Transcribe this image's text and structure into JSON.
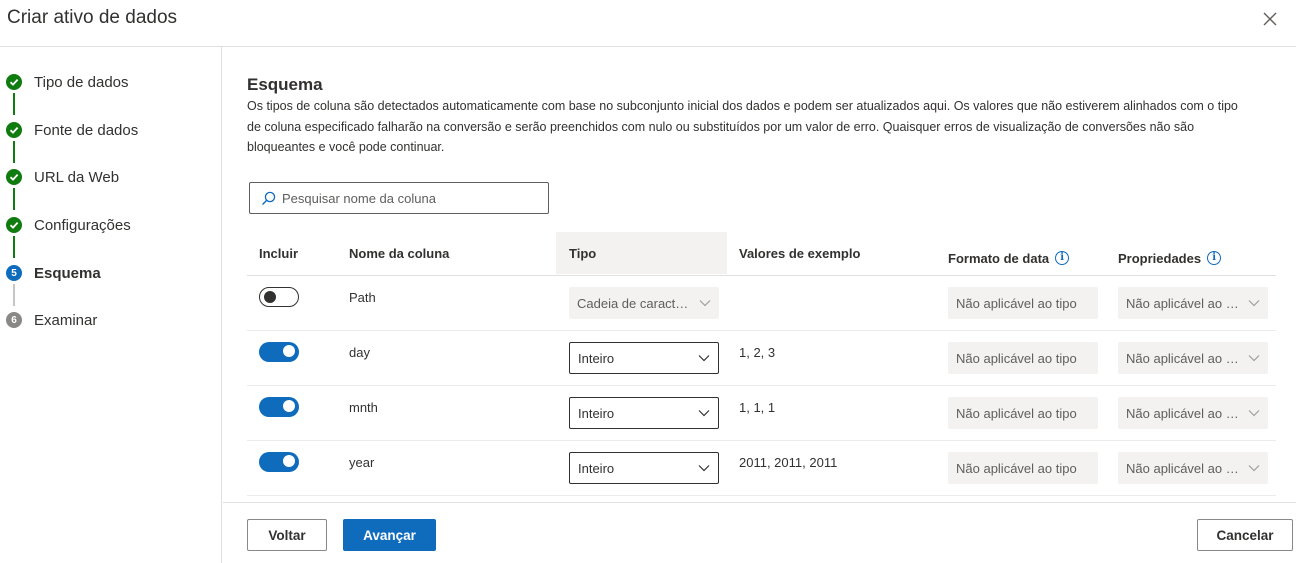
{
  "dialog": {
    "title": "Criar ativo de dados"
  },
  "steps": [
    {
      "label": "Tipo de dados",
      "state": "done"
    },
    {
      "label": "Fonte de dados",
      "state": "done"
    },
    {
      "label": "URL da Web",
      "state": "done"
    },
    {
      "label": "Configurações",
      "state": "done"
    },
    {
      "label": "Esquema",
      "state": "current",
      "number": "5"
    },
    {
      "label": "Examinar",
      "state": "pending",
      "number": "6"
    }
  ],
  "schema": {
    "title": "Esquema",
    "description": "Os tipos de coluna são detectados automaticamente com base no subconjunto inicial dos dados e podem ser atualizados aqui. Os valores que não estiverem alinhados com o tipo de coluna especificado falharão na conversão e serão preenchidos com nulo ou substituídos por um valor de erro. Quaisquer erros de visualização de conversões não são bloqueantes e você pode continuar.",
    "search_placeholder": "Pesquisar nome da coluna"
  },
  "table": {
    "headers": {
      "include": "Incluir",
      "column_name": "Nome da coluna",
      "type": "Tipo",
      "sample_values": "Valores de exemplo",
      "date_format": "Formato de data",
      "properties": "Propriedades"
    },
    "rows": [
      {
        "include": false,
        "name": "Path",
        "type": "Cadeia de caracteres",
        "type_enabled": false,
        "sample": "",
        "date_format": "Não aplicável ao tipo",
        "properties": "Não aplicável ao tipo"
      },
      {
        "include": true,
        "name": "day",
        "type": "Inteiro",
        "type_enabled": true,
        "sample": "1, 2, 3",
        "date_format": "Não aplicável ao tipo",
        "properties": "Não aplicável ao tipo"
      },
      {
        "include": true,
        "name": "mnth",
        "type": "Inteiro",
        "type_enabled": true,
        "sample": "1, 1, 1",
        "date_format": "Não aplicável ao tipo",
        "properties": "Não aplicável ao tipo"
      },
      {
        "include": true,
        "name": "year",
        "type": "Inteiro",
        "type_enabled": true,
        "sample": "2011, 2011, 2011",
        "date_format": "Não aplicável ao tipo",
        "properties": "Não aplicável ao tipo"
      }
    ]
  },
  "footer": {
    "back": "Voltar",
    "next": "Avançar",
    "cancel": "Cancelar"
  },
  "colors": {
    "accent": "#0f6cbd",
    "done": "#107c10",
    "pending": "#8a8886"
  }
}
